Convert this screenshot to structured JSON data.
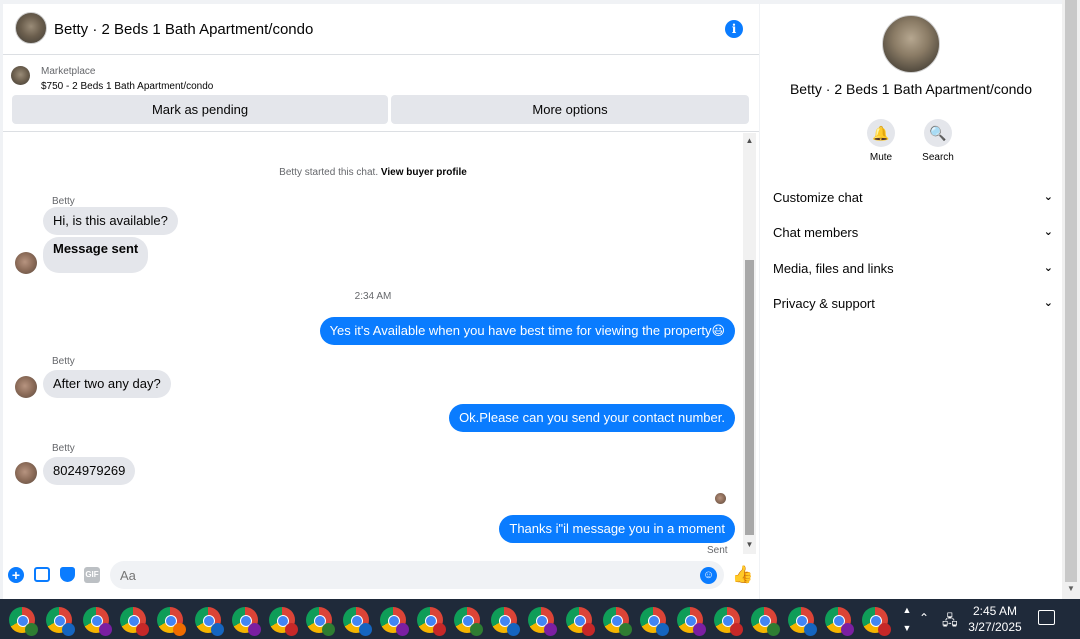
{
  "header": {
    "title": "Betty · 2 Beds 1 Bath Apartment/condo"
  },
  "listing": {
    "source": "Marketplace",
    "price_title": "$750 - 2 Beds 1 Bath Apartment/condo",
    "mark_pending_label": "Mark as pending",
    "more_options_label": "More options"
  },
  "chat": {
    "system_note_prefix": "Betty started this chat.",
    "system_note_link": "View buyer profile",
    "time_1": "2:34 AM",
    "sent_label": "Sent",
    "messages": [
      {
        "sender": "Betty",
        "text": "Hi, is this available?"
      },
      {
        "text": "Message sent"
      },
      {
        "text": "Yes it's Available when you have best time for viewing the property😃"
      },
      {
        "sender": "Betty",
        "text": "After two any day?"
      },
      {
        "text": "Ok.Please can you send your contact number."
      },
      {
        "sender": "Betty",
        "text": "8024979269"
      },
      {
        "text": "Thanks i\"il message you in a moment"
      }
    ]
  },
  "composer": {
    "placeholder": "Aa",
    "gif_label": "GIF"
  },
  "details": {
    "title": "Betty · 2 Beds 1 Bath Apartment/condo",
    "actions": {
      "mute": "Mute",
      "search": "Search"
    },
    "sections": [
      "Customize chat",
      "Chat members",
      "Media, files and links",
      "Privacy & support"
    ]
  },
  "taskbar": {
    "time": "2:45 AM",
    "date": "3/27/2025",
    "icon_count": 24
  },
  "colors": {
    "accent": "#0a7cff",
    "bubble_in": "#e4e6eb",
    "taskbar": "#1f2a3a"
  }
}
